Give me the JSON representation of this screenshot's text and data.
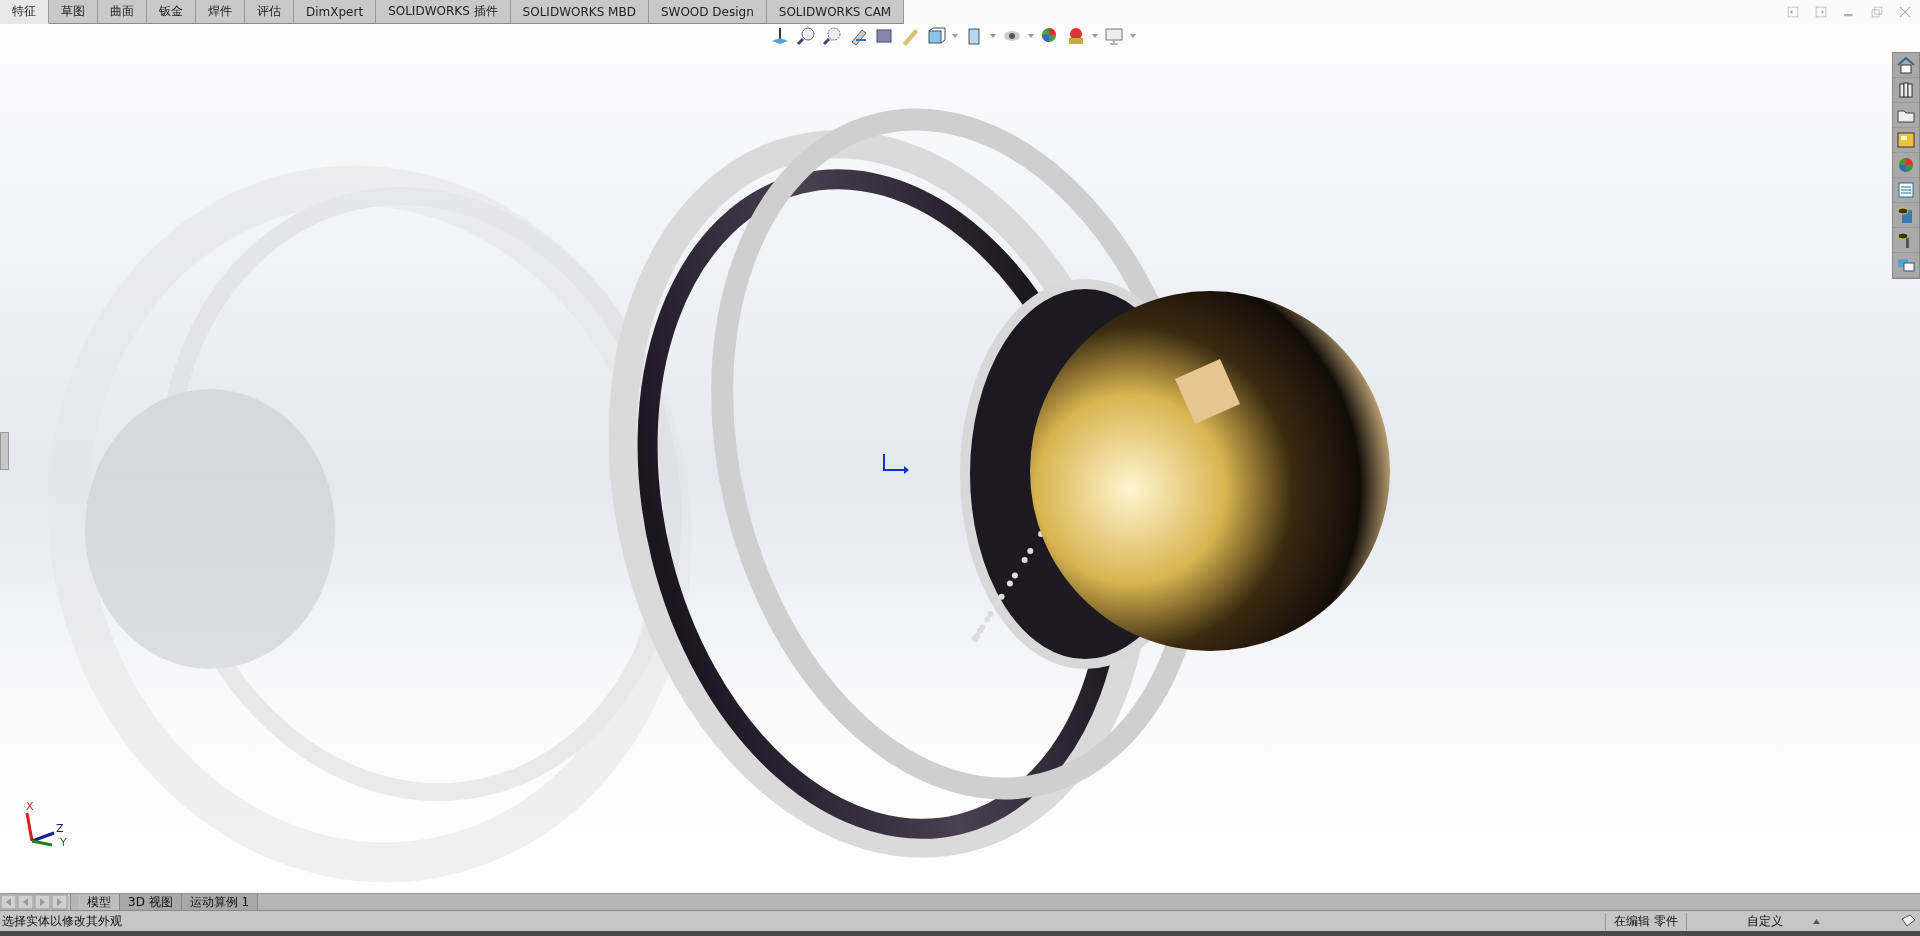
{
  "command_tabs": [
    {
      "label": "特征",
      "selected": true
    },
    {
      "label": "草图",
      "selected": false
    },
    {
      "label": "曲面",
      "selected": false
    },
    {
      "label": "钣金",
      "selected": false
    },
    {
      "label": "焊件",
      "selected": false
    },
    {
      "label": "评估",
      "selected": false
    },
    {
      "label": "DimXpert",
      "selected": false
    },
    {
      "label": "SOLIDWORKS 插件",
      "selected": false
    },
    {
      "label": "SOLIDWORKS MBD",
      "selected": false
    },
    {
      "label": "SWOOD Design",
      "selected": false
    },
    {
      "label": "SOLIDWORKS CAM",
      "selected": false
    }
  ],
  "triad": {
    "x": "X",
    "y": "Y",
    "z": "Z"
  },
  "model_tabs": [
    {
      "label": "模型",
      "selected": true
    },
    {
      "label": "3D 视图",
      "selected": false
    },
    {
      "label": "运动算例 1",
      "selected": false
    }
  ],
  "status_bar": {
    "message": "选择实体以修改其外观",
    "mode": "在编辑 零件",
    "units": "自定义"
  }
}
